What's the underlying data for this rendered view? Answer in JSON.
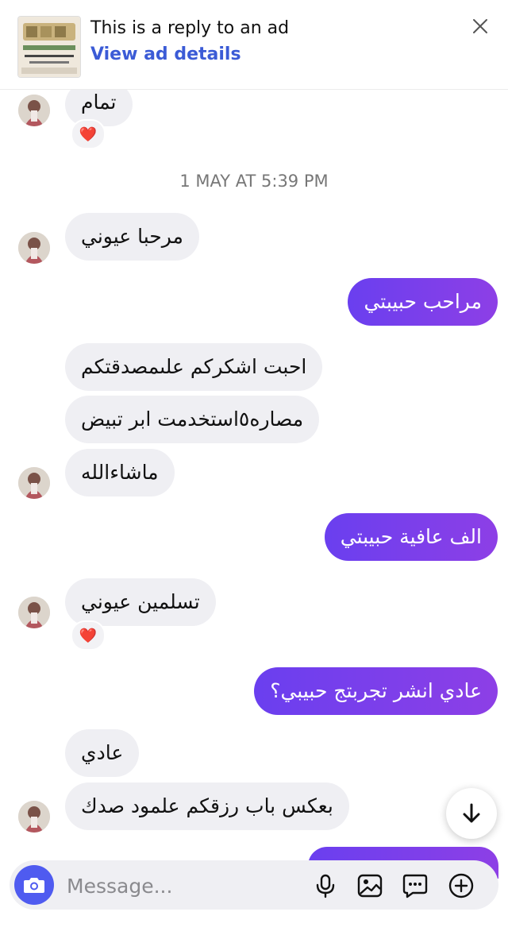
{
  "ad_banner": {
    "title": "This is a reply to an ad",
    "link": "View ad details",
    "close_icon": "close-icon"
  },
  "timestamp": "1 MAY AT 5:39 PM",
  "messages": [
    {
      "dir": "in",
      "text": "تمام",
      "reaction": "❤️"
    },
    {
      "dir": "in",
      "text": "مرحبا عيوني"
    },
    {
      "dir": "out",
      "text": "مراحب حبيبتي"
    },
    {
      "dir": "in",
      "text": "احبت اشكركم علىمصدقتكم"
    },
    {
      "dir": "in",
      "text": "مصاره٥استخدمت ابر تبيض"
    },
    {
      "dir": "in",
      "text": "ماشاءالله"
    },
    {
      "dir": "out",
      "text": "الف عافية حبيبتي"
    },
    {
      "dir": "in",
      "text": "تسلمين عيوني",
      "reaction": "❤️"
    },
    {
      "dir": "out",
      "text": "عادي انشر تجربتج حبيبي؟"
    },
    {
      "dir": "in",
      "text": "عادي"
    },
    {
      "dir": "in",
      "text": "بعكس باب رزقكم علمود صدك"
    }
  ],
  "composer": {
    "placeholder": "Message...",
    "icons": [
      "camera-icon",
      "microphone-icon",
      "image-icon",
      "sticker-icon",
      "plus-icon"
    ]
  },
  "colors": {
    "outgoing_start": "#6a3fef",
    "outgoing_end": "#8d3fe6",
    "incoming": "#efeff3",
    "link": "#3b5bd6",
    "camera_button": "#4f5bf0"
  }
}
